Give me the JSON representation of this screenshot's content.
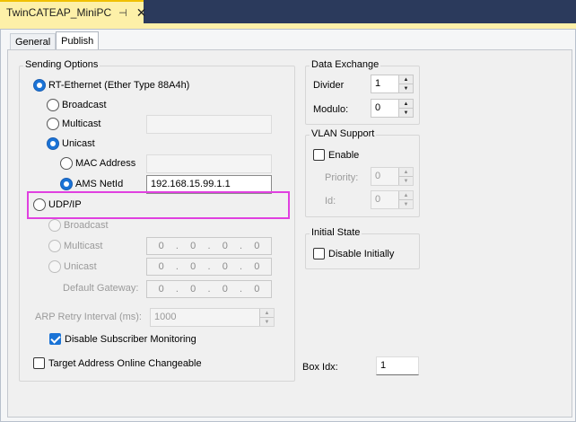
{
  "window": {
    "doc_tab_title": "TwinCATEAP_MiniPC",
    "pin_glyph": "⊣",
    "close_glyph": "✕"
  },
  "tabs": [
    {
      "label": "General"
    },
    {
      "label": "Publish"
    }
  ],
  "sending_options": {
    "title": "Sending Options",
    "rt_ethernet": "RT-Ethernet (Ether Type 88A4h)",
    "broadcast": "Broadcast",
    "multicast": "Multicast",
    "unicast": "Unicast",
    "mac_address": "MAC Address",
    "ams_netid": "AMS NetId",
    "ams_netid_value": "192.168.15.99.1.1",
    "udp_ip": "UDP/IP",
    "udp_broadcast": "Broadcast",
    "udp_multicast": "Multicast",
    "udp_multicast_ip": [
      "0",
      "0",
      "0",
      "0"
    ],
    "udp_unicast": "Unicast",
    "udp_unicast_ip": [
      "0",
      "0",
      "0",
      "0"
    ],
    "default_gateway": "Default Gateway:",
    "default_gateway_ip": [
      "0",
      "0",
      "0",
      "0"
    ],
    "arp_retry_label": "ARP Retry Interval (ms):",
    "arp_retry_value": "1000",
    "disable_subscriber_monitoring": "Disable Subscriber Monitoring",
    "target_address_changeable": "Target Address Online Changeable"
  },
  "data_exchange": {
    "title": "Data Exchange",
    "divider_label": "Divider",
    "divider_value": "1",
    "modulo_label": "Modulo:",
    "modulo_value": "0"
  },
  "vlan_support": {
    "title": "VLAN Support",
    "enable": "Enable",
    "priority_label": "Priority:",
    "priority_value": "0",
    "id_label": "Id:",
    "id_value": "0"
  },
  "initial_state": {
    "title": "Initial State",
    "disable_initially": "Disable Initially"
  },
  "box_idx": {
    "label": "Box Idx:",
    "value": "1"
  },
  "colors": {
    "accent": "#1a73d6",
    "tab_yellow": "#fdf0a8",
    "highlight": "#e040e0"
  }
}
